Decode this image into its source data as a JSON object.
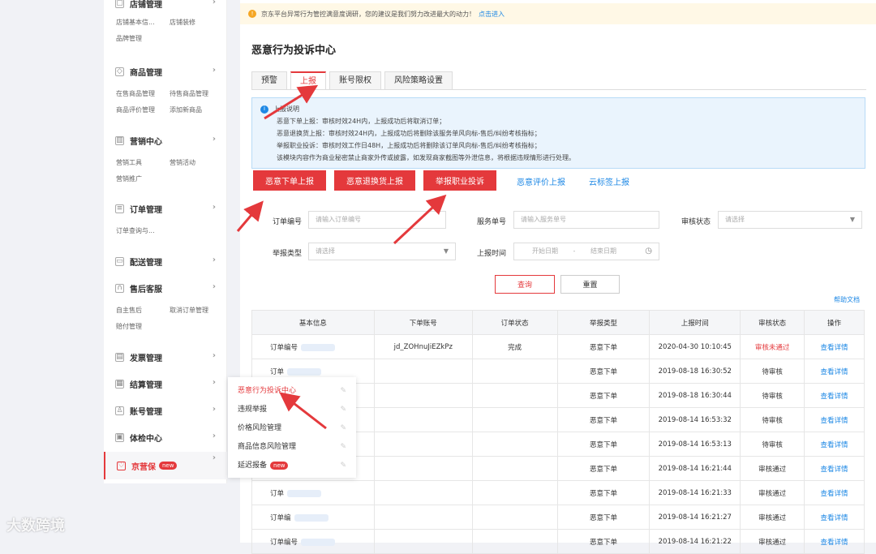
{
  "sidebar": {
    "sections": [
      {
        "icon": "store-icon",
        "title": "店铺管理",
        "items": [
          "店铺基本信...",
          "店铺装修",
          "品牌管理"
        ]
      },
      {
        "icon": "bag-icon",
        "title": "商品管理",
        "items": [
          "在售商品管理",
          "待售商品管理",
          "商品评价管理",
          "添加新商品"
        ]
      },
      {
        "icon": "chart-icon",
        "title": "营销中心",
        "items": [
          "营销工具",
          "营销活动",
          "营销推广"
        ]
      },
      {
        "icon": "order-icon",
        "title": "订单管理",
        "items": [
          "订单查询与..."
        ]
      },
      {
        "icon": "truck-icon",
        "title": "配送管理",
        "items": []
      },
      {
        "icon": "headset-icon",
        "title": "售后客服",
        "items": [
          "自主售后",
          "取消订单管理",
          "赔付管理"
        ]
      },
      {
        "icon": "invoice-icon",
        "title": "发票管理",
        "items": []
      },
      {
        "icon": "settle-icon",
        "title": "结算管理",
        "items": []
      },
      {
        "icon": "user-icon",
        "title": "账号管理",
        "items": []
      },
      {
        "icon": "check-icon",
        "title": "体检中心",
        "items": []
      },
      {
        "icon": "shield-icon",
        "title": "京营保",
        "items": [],
        "badge": "new"
      }
    ]
  },
  "popup": {
    "items": [
      {
        "label": "恶意行为投诉中心",
        "active": true
      },
      {
        "label": "违规举报"
      },
      {
        "label": "价格风险管理"
      },
      {
        "label": "商品信息风险管理"
      },
      {
        "label": "延迟报备",
        "badge": "new"
      }
    ]
  },
  "notice": {
    "text": "京东平台异常行为管控满意度调研，您的建议是我们努力改进最大的动力！",
    "link": "点击进入"
  },
  "page_title": "恶意行为投诉中心",
  "tabs": [
    "预警",
    "上报",
    "账号限权",
    "风险策略设置"
  ],
  "info": {
    "title": "上报说明",
    "lines": [
      "恶意下单上报：审核时效24H内，上报成功后将取消订单；",
      "恶意退换货上报：审核时效24H内，上报成功后将删除该服务单风向标-售后/纠纷考核指标；",
      "举报职业投诉：审核时效工作日48H，上报成功后将删除该订单风向标-售后/纠纷考核指标；",
      "该模块内容作为商业秘密禁止商家外传或披露，如发现商家截图等外泄信息，将根据违规情形进行处理。"
    ]
  },
  "action_buttons": [
    "恶意下单上报",
    "恶意退换货上报",
    "举报职业投诉"
  ],
  "action_links": [
    "恶意评价上报",
    "云标签上报"
  ],
  "filters": {
    "order_no_label": "订单编号",
    "order_no_placeholder": "请输入订单编号",
    "service_no_label": "服务单号",
    "service_no_placeholder": "请输入服务单号",
    "audit_label": "审核状态",
    "audit_placeholder": "请选择",
    "type_label": "举报类型",
    "type_placeholder": "请选择",
    "time_label": "上报时间",
    "start_placeholder": "开始日期",
    "end_placeholder": "结束日期",
    "dash": "-"
  },
  "query_button": "查询",
  "reset_button": "重置",
  "help_link": "帮助文档",
  "table": {
    "headers": [
      "基本信息",
      "下单账号",
      "订单状态",
      "举报类型",
      "上报时间",
      "审核状态",
      "操作"
    ],
    "rows": [
      {
        "info": "订单编号",
        "account": "jd_ZOHnuJiEZkPz",
        "status": "完成",
        "type": "恶意下单",
        "time": "2020-04-30 10:10:45",
        "audit": "审核未通过",
        "op": "查看详情",
        "audit_red": true
      },
      {
        "info": "订单",
        "account": "",
        "status": "",
        "type": "恶意下单",
        "time": "2019-08-18 16:30:52",
        "audit": "待审核",
        "op": "查看详情"
      },
      {
        "info": "",
        "account": "",
        "status": "",
        "type": "恶意下单",
        "time": "2019-08-18 16:30:44",
        "audit": "待审核",
        "op": "查看详情"
      },
      {
        "info": "",
        "account": "",
        "status": "",
        "type": "恶意下单",
        "time": "2019-08-14 16:53:32",
        "audit": "待审核",
        "op": "查看详情"
      },
      {
        "info": "",
        "account": "",
        "status": "",
        "type": "恶意下单",
        "time": "2019-08-14 16:53:13",
        "audit": "待审核",
        "op": "查看详情"
      },
      {
        "info": "",
        "account": "",
        "status": "",
        "type": "恶意下单",
        "time": "2019-08-14 16:21:44",
        "audit": "审核通过",
        "op": "查看详情"
      },
      {
        "info": "订单",
        "account": "",
        "status": "",
        "type": "恶意下单",
        "time": "2019-08-14 16:21:33",
        "audit": "审核通过",
        "op": "查看详情"
      },
      {
        "info": "订单编",
        "account": "",
        "status": "",
        "type": "恶意下单",
        "time": "2019-08-14 16:21:27",
        "audit": "审核通过",
        "op": "查看详情"
      },
      {
        "info": "订单编号",
        "account": "",
        "status": "",
        "type": "恶意下单",
        "time": "2019-08-14 16:21:22",
        "audit": "审核通过",
        "op": "查看详情"
      }
    ]
  },
  "watermark": "大数跨境",
  "colors": {
    "accent": "#e4393c",
    "link": "#1e88e5",
    "info_bg": "#eaf4fd"
  }
}
